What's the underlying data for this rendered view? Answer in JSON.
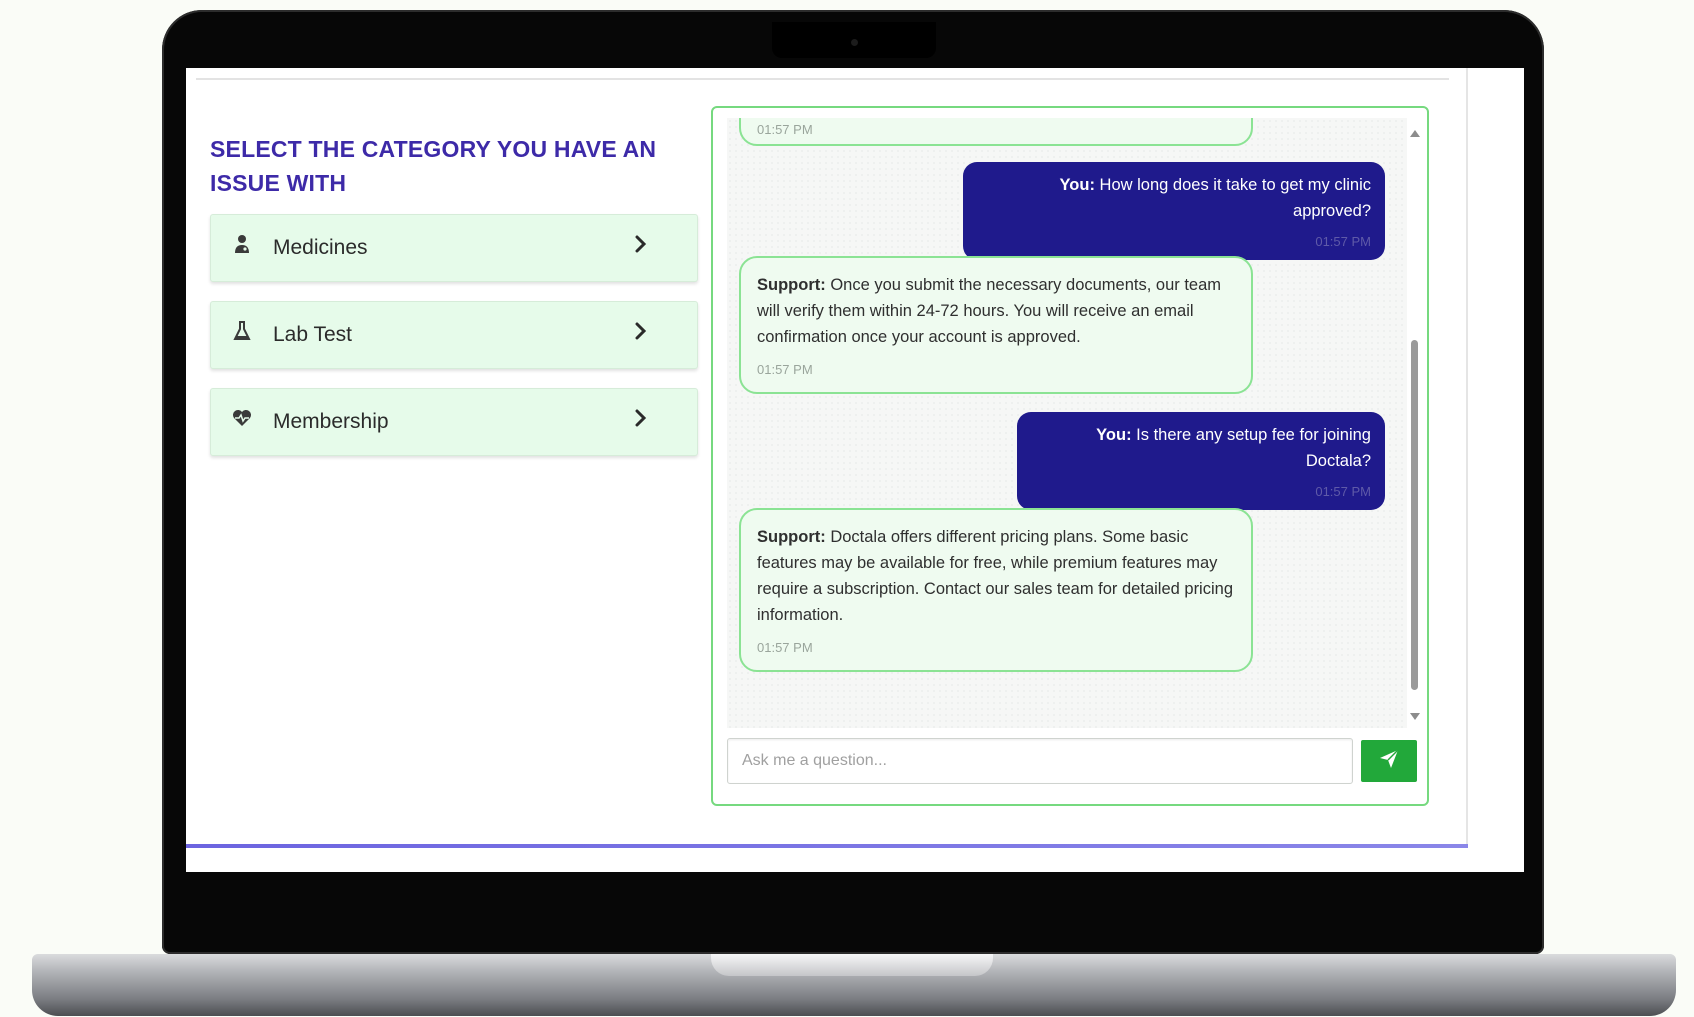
{
  "sidebar": {
    "title": "SELECT THE CATEGORY YOU HAVE AN ISSUE WITH",
    "categories": [
      {
        "label": "Medicines",
        "icon": "doctor-icon"
      },
      {
        "label": "Lab Test",
        "icon": "flask-icon"
      },
      {
        "label": "Membership",
        "icon": "heart-pulse-icon"
      }
    ]
  },
  "chat": {
    "messages": [
      {
        "sender": "Support",
        "text": "",
        "time": "01:57 PM"
      },
      {
        "sender": "You",
        "sender_label": "You:",
        "text": " How long does it take to get my clinic approved?",
        "time": "01:57 PM"
      },
      {
        "sender": "Support",
        "sender_label": "Support:",
        "text": " Once you submit the necessary documents, our team will verify them within 24-72 hours. You will receive an email confirmation once your account is approved.",
        "time": "01:57 PM"
      },
      {
        "sender": "You",
        "sender_label": "You:",
        "text": " Is there any setup fee for joining Doctala?",
        "time": "01:57 PM"
      },
      {
        "sender": "Support",
        "sender_label": "Support:",
        "text": " Doctala offers different pricing plans. Some basic features may be available for free, while premium features may require a subscription. Contact our sales team for detailed pricing information.",
        "time": "01:57 PM"
      }
    ],
    "input_placeholder": "Ask me a question...",
    "send_icon": "paper-plane-icon"
  },
  "colors": {
    "title": "#3d2aa8",
    "category_bg": "#e6fbea",
    "user_bubble": "#1f1a8c",
    "support_border": "#8be394",
    "send_button": "#22a83a"
  }
}
